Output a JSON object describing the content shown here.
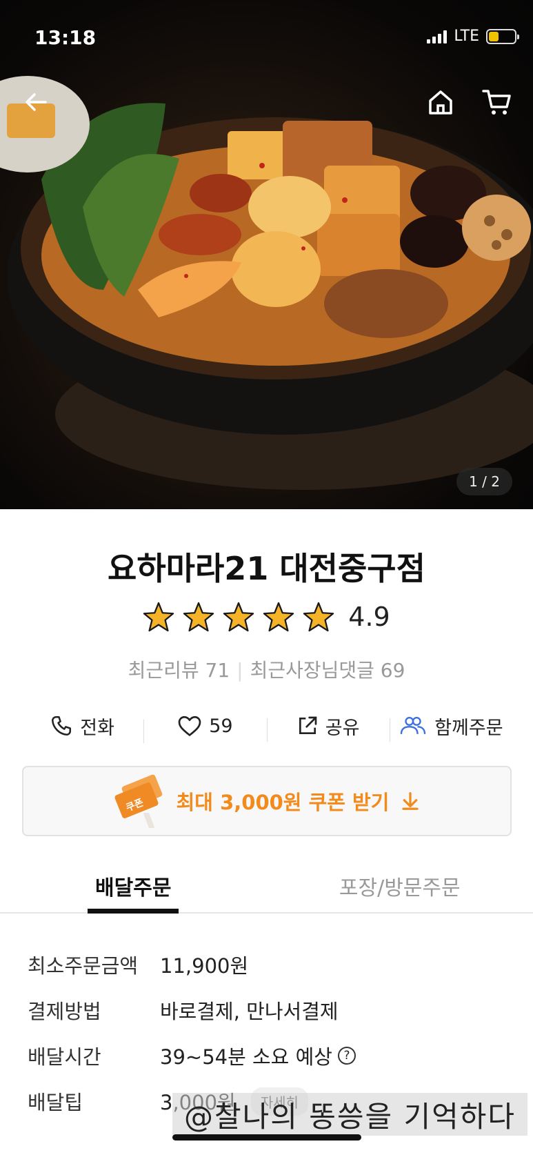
{
  "status_bar": {
    "time": "13:18",
    "network": "LTE"
  },
  "hero": {
    "page_counter": "1 / 2",
    "icons": [
      "back-arrow-icon",
      "home-icon",
      "cart-icon"
    ]
  },
  "store": {
    "name": "요하마라21 대전중구점",
    "rating": "4.9",
    "rating_value": 4.9,
    "stars": 5,
    "recent_reviews_label": "최근리뷰 71",
    "owner_replies_label": "최근사장님댓글 69"
  },
  "actions": {
    "call": "전화",
    "likes": "59",
    "share": "공유",
    "group_order": "함께주문"
  },
  "coupon": {
    "label": "최대 3,000원 쿠폰 받기",
    "badge": "쿠폰",
    "accent_color": "#f28a1c"
  },
  "tabs": {
    "delivery": "배달주문",
    "pickup": "포장/방문주문"
  },
  "info": {
    "min_order": {
      "label": "최소주문금액",
      "value": "11,900원"
    },
    "payment": {
      "label": "결제방법",
      "value": "바로결제, 만나서결제"
    },
    "delivery_time": {
      "label": "배달시간",
      "value": "39~54분 소요 예상",
      "help": "?"
    },
    "delivery_tip": {
      "label": "배달팁",
      "value": "3,000원",
      "detail": "자세히"
    }
  },
  "watermark": "@찰나의 똥씅을 기억하다"
}
